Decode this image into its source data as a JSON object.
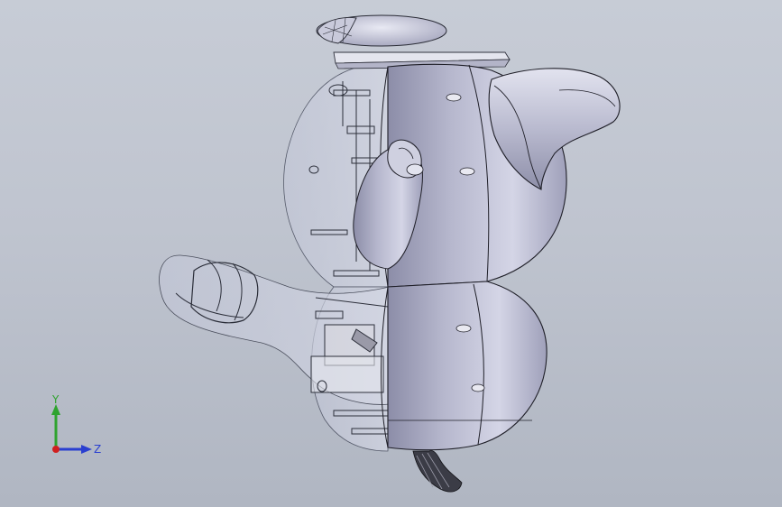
{
  "viewport": {
    "background_top": "#c7ccd6",
    "background_bottom": "#b0b6c2"
  },
  "model": {
    "shell_color": "#b8b9ce",
    "transparent_color": "#c8ccdc",
    "edge_color": "#1f1f28"
  },
  "triad": {
    "y_label": "Y",
    "z_label": "Z",
    "y_color": "#2fa32f",
    "z_color": "#2a3fd0",
    "x_color": "#d02020"
  }
}
